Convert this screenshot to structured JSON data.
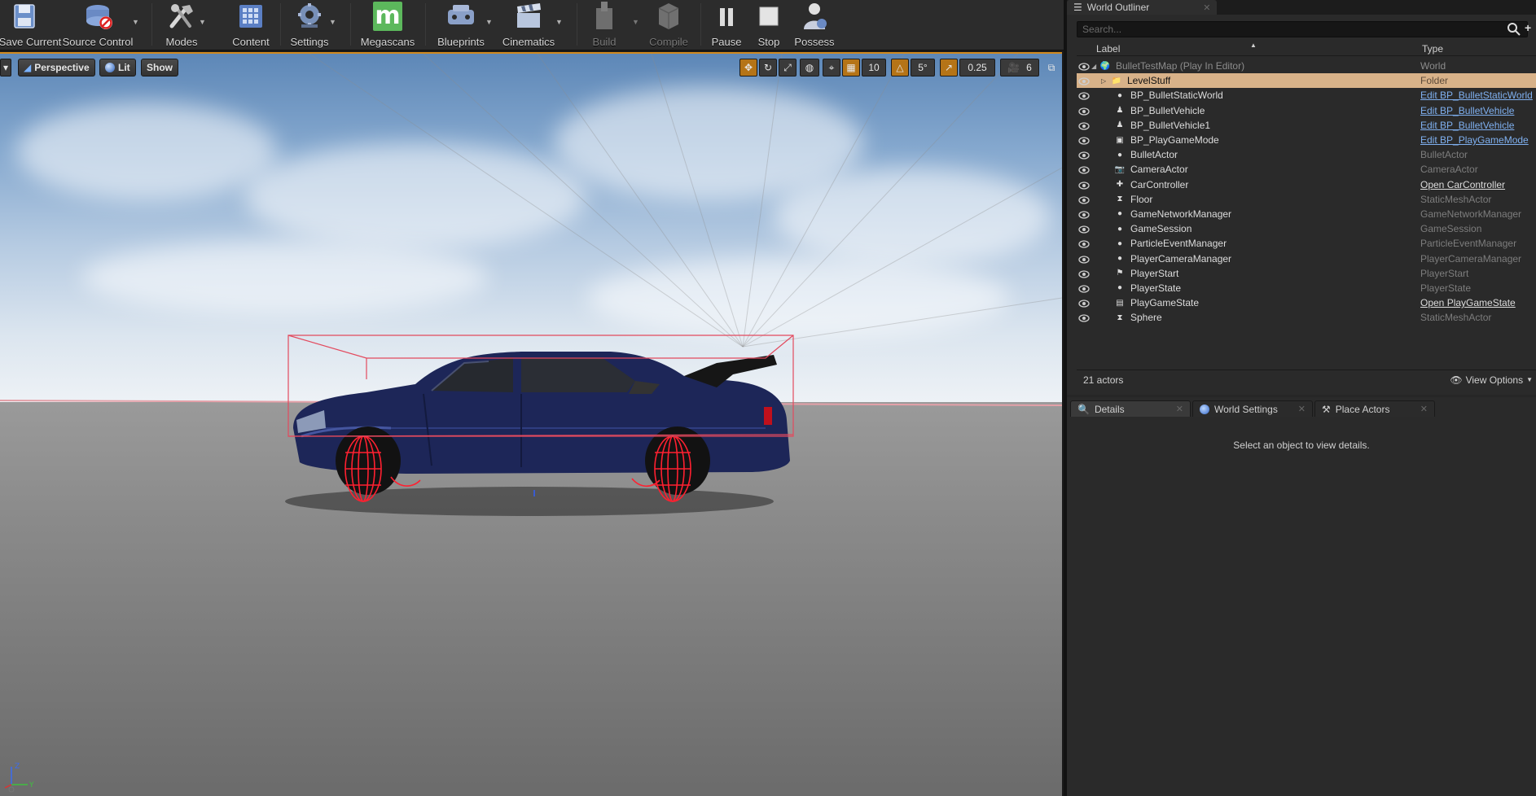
{
  "toolbar": {
    "items": [
      {
        "label": "Save Current",
        "icon": "save-icon"
      },
      {
        "label": "Source Control",
        "icon": "source-control-icon"
      },
      {
        "label": "Modes",
        "icon": "modes-icon"
      },
      {
        "label": "Content",
        "icon": "content-icon"
      },
      {
        "label": "Settings",
        "icon": "settings-icon"
      },
      {
        "label": "Megascans",
        "icon": "megascans-icon"
      },
      {
        "label": "Blueprints",
        "icon": "blueprints-icon"
      },
      {
        "label": "Cinematics",
        "icon": "cinematics-icon"
      },
      {
        "label": "Build",
        "icon": "build-icon"
      },
      {
        "label": "Compile",
        "icon": "compile-icon"
      },
      {
        "label": "Pause",
        "icon": "pause-icon"
      },
      {
        "label": "Stop",
        "icon": "stop-icon"
      },
      {
        "label": "Possess",
        "icon": "possess-icon"
      }
    ],
    "megascans_letter": "m"
  },
  "viewport": {
    "perspective_label": "Perspective",
    "lit_label": "Lit",
    "show_label": "Show",
    "grid_snap": "10",
    "rotation_snap": "5°",
    "scale_snap": "0.25",
    "camera_speed": "6",
    "axis_z": "Z",
    "axis_y": "Y",
    "colors": {
      "accent": "#d18a1f",
      "bounds": "#e0284a",
      "car_body": "#1b2354"
    }
  },
  "outliner": {
    "title": "World Outliner",
    "search_placeholder": "Search...",
    "col_label": "Label",
    "col_type": "Type",
    "rows": [
      {
        "label": "BulletTestMap (Play In Editor)",
        "type": "World",
        "kind": "world",
        "icon": "world-icon"
      },
      {
        "label": "LevelStuff",
        "type": "Folder",
        "kind": "folder",
        "icon": "folder-icon"
      },
      {
        "label": "BP_BulletStaticWorld",
        "type": "Edit BP_BulletStaticWorld",
        "kind": "link",
        "icon": "sphere-icon"
      },
      {
        "label": "BP_BulletVehicle",
        "type": "Edit BP_BulletVehicle",
        "kind": "link",
        "icon": "pawn-icon"
      },
      {
        "label": "BP_BulletVehicle1",
        "type": "Edit BP_BulletVehicle",
        "kind": "link",
        "icon": "pawn-icon"
      },
      {
        "label": "BP_PlayGameMode",
        "type": "Edit BP_PlayGameMode",
        "kind": "link",
        "icon": "gamemode-icon"
      },
      {
        "label": "BulletActor",
        "type": "BulletActor",
        "kind": "plain",
        "icon": "sphere-icon"
      },
      {
        "label": "CameraActor",
        "type": "CameraActor",
        "kind": "plain",
        "icon": "camera-icon"
      },
      {
        "label": "CarController",
        "type": "Open CarController",
        "kind": "link-light",
        "icon": "controller-icon"
      },
      {
        "label": "Floor",
        "type": "StaticMeshActor",
        "kind": "plain",
        "icon": "static-mesh-icon"
      },
      {
        "label": "GameNetworkManager",
        "type": "GameNetworkManager",
        "kind": "plain",
        "icon": "sphere-icon"
      },
      {
        "label": "GameSession",
        "type": "GameSession",
        "kind": "plain",
        "icon": "sphere-icon"
      },
      {
        "label": "ParticleEventManager",
        "type": "ParticleEventManager",
        "kind": "plain",
        "icon": "sphere-icon"
      },
      {
        "label": "PlayerCameraManager",
        "type": "PlayerCameraManager",
        "kind": "plain",
        "icon": "sphere-icon"
      },
      {
        "label": "PlayerStart",
        "type": "PlayerStart",
        "kind": "plain",
        "icon": "player-start-icon"
      },
      {
        "label": "PlayerState",
        "type": "PlayerState",
        "kind": "plain",
        "icon": "sphere-icon"
      },
      {
        "label": "PlayGameState",
        "type": "Open PlayGameState",
        "kind": "link-light",
        "icon": "gamestate-icon"
      },
      {
        "label": "Sphere",
        "type": "StaticMeshActor",
        "kind": "plain",
        "icon": "static-mesh-icon"
      }
    ],
    "actor_count": "21 actors",
    "view_options": "View Options"
  },
  "details": {
    "tabs": [
      {
        "label": "Details",
        "icon": "details-icon"
      },
      {
        "label": "World Settings",
        "icon": "globe-icon"
      },
      {
        "label": "Place Actors",
        "icon": "place-actors-icon"
      }
    ],
    "message": "Select an object to view details."
  }
}
